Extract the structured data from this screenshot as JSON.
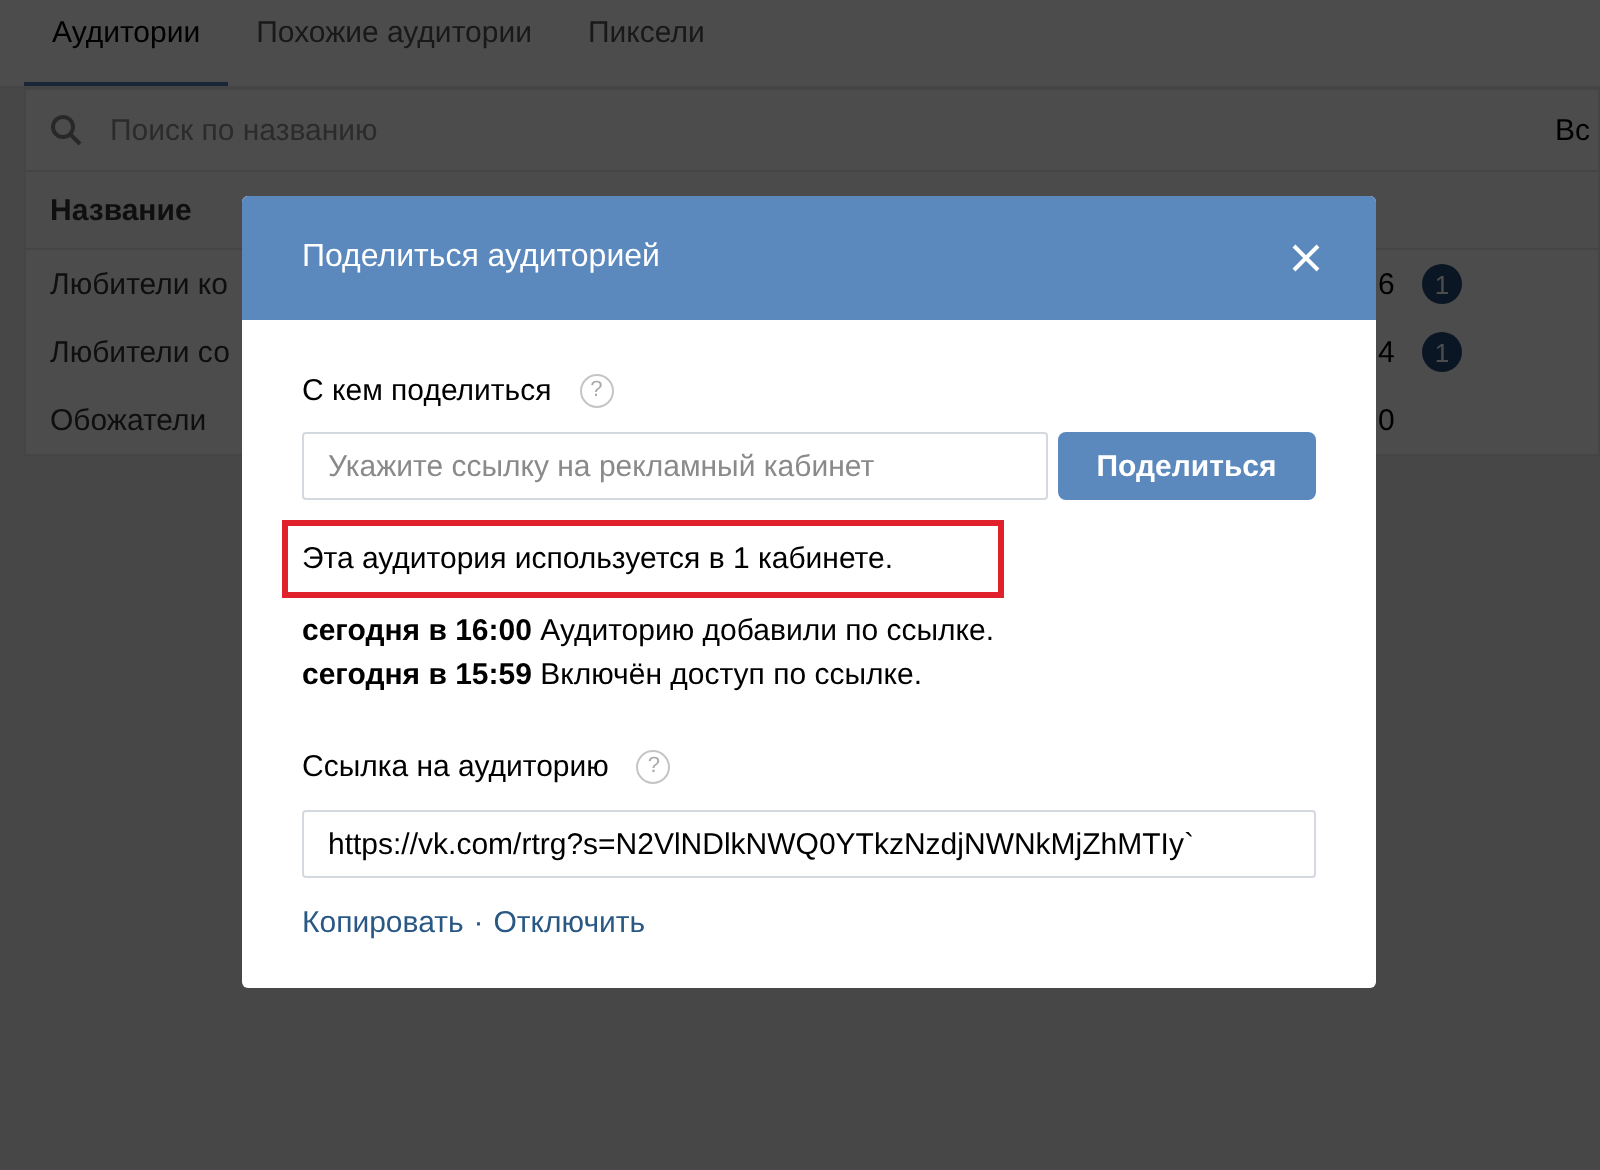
{
  "tabs": [
    {
      "label": "Аудитории",
      "selected": true
    },
    {
      "label": "Похожие аудитории",
      "selected": false
    },
    {
      "label": "Пиксели",
      "selected": false
    }
  ],
  "search": {
    "placeholder": "Поиск по названию",
    "filter": "Вс"
  },
  "table": {
    "columns": [
      "Название"
    ],
    "rows": [
      {
        "name": "Любители ко",
        "value": "6",
        "badge": "1"
      },
      {
        "name": "Любители со",
        "value": "4",
        "badge": "1"
      },
      {
        "name": "Обожатели",
        "value": "0"
      }
    ]
  },
  "dialog": {
    "title": "Поделиться аудиторией",
    "share_label": "С кем поделиться",
    "share_placeholder": "Укажите ссылку на рекламный кабинет",
    "share_button": "Поделиться",
    "notice": "Эта аудитория используется в 1 кабинете.",
    "history": [
      "**сегодня в 16:00** Аудиторию добавили по ссылке.",
      "**сегодня в 15:59** Включён доступ по ссылке."
    ],
    "link_label": "Ссылка на аудиторию",
    "link_value": "https://vk.com/rtrg?s=N2VlNDlkNWQ0YTkzNzdjNWNkMjZhMTIy`",
    "actions": [
      "Копировать",
      "Отключить"
    ],
    "separator": "·",
    "help_glyph": "?"
  }
}
